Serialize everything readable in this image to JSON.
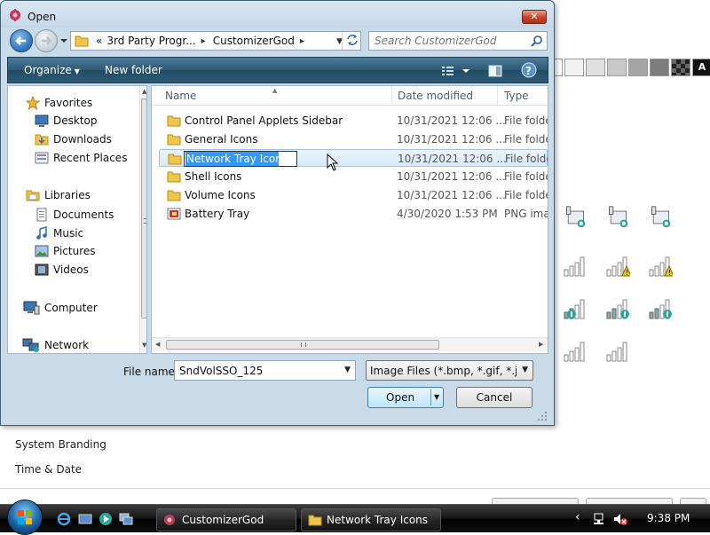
{
  "background_app": {
    "sidebar_items": [
      "System Branding",
      "Time & Date"
    ],
    "swatch_label": "A",
    "colors": {
      "swatches": [
        "#ffffff",
        "#f2f2f2",
        "#e6e6e6",
        "#d2d2d2",
        "#bfbfbf",
        "#9a9a9a",
        "#6e6e6e",
        "#2e2e2e",
        "#1a1a1a",
        "#000000"
      ]
    }
  },
  "dialog": {
    "title": "Open",
    "close_glyph": "✕",
    "address": {
      "overflow": "«",
      "segments": [
        "3rd Party Progr...",
        "CustomizerGod"
      ],
      "separator": "▸"
    },
    "search": {
      "placeholder": "Search CustomizerGod"
    },
    "toolbar": {
      "organize": "Organize",
      "new_folder": "New folder"
    },
    "nav": {
      "favorites_header": "Favorites",
      "favorites": [
        "Desktop",
        "Downloads",
        "Recent Places"
      ],
      "libraries_header": "Libraries",
      "libraries": [
        "Documents",
        "Music",
        "Pictures",
        "Videos"
      ],
      "computer": "Computer",
      "network": "Network"
    },
    "columns": {
      "name": "Name",
      "date": "Date modified",
      "type": "Type"
    },
    "files": [
      {
        "name": "Control Panel Applets Sidebar",
        "date": "10/31/2021 12:06 ...",
        "type": "File folder",
        "icon": "folder-icon"
      },
      {
        "name": "General Icons",
        "date": "10/31/2021 12:06 ...",
        "type": "File folder",
        "icon": "folder-icon"
      },
      {
        "name": "Network Tray Icons",
        "date": "10/31/2021 12:06 ...",
        "type": "File folder",
        "icon": "folder-icon",
        "selected": true,
        "renaming": true
      },
      {
        "name": "Shell Icons",
        "date": "10/31/2021 12:06 ...",
        "type": "File folder",
        "icon": "folder-icon"
      },
      {
        "name": "Volume Icons",
        "date": "10/31/2021 12:06 ...",
        "type": "File folder",
        "icon": "folder-icon"
      },
      {
        "name": "Battery Tray",
        "date": "4/30/2020 1:53 PM",
        "type": "PNG imag",
        "icon": "png-file-icon"
      }
    ],
    "file_name_label": "File name:",
    "file_name_value": "SndVolSSO_125",
    "file_type_value": "Image Files (*.bmp, *.gif, *.jpg, *.",
    "open_button": "Open",
    "cancel_button": "Cancel"
  },
  "taskbar": {
    "tasks": [
      "CustomizerGod",
      "Network Tray Icons"
    ],
    "tray_chevron": "‹",
    "clock": "9:38 PM"
  }
}
